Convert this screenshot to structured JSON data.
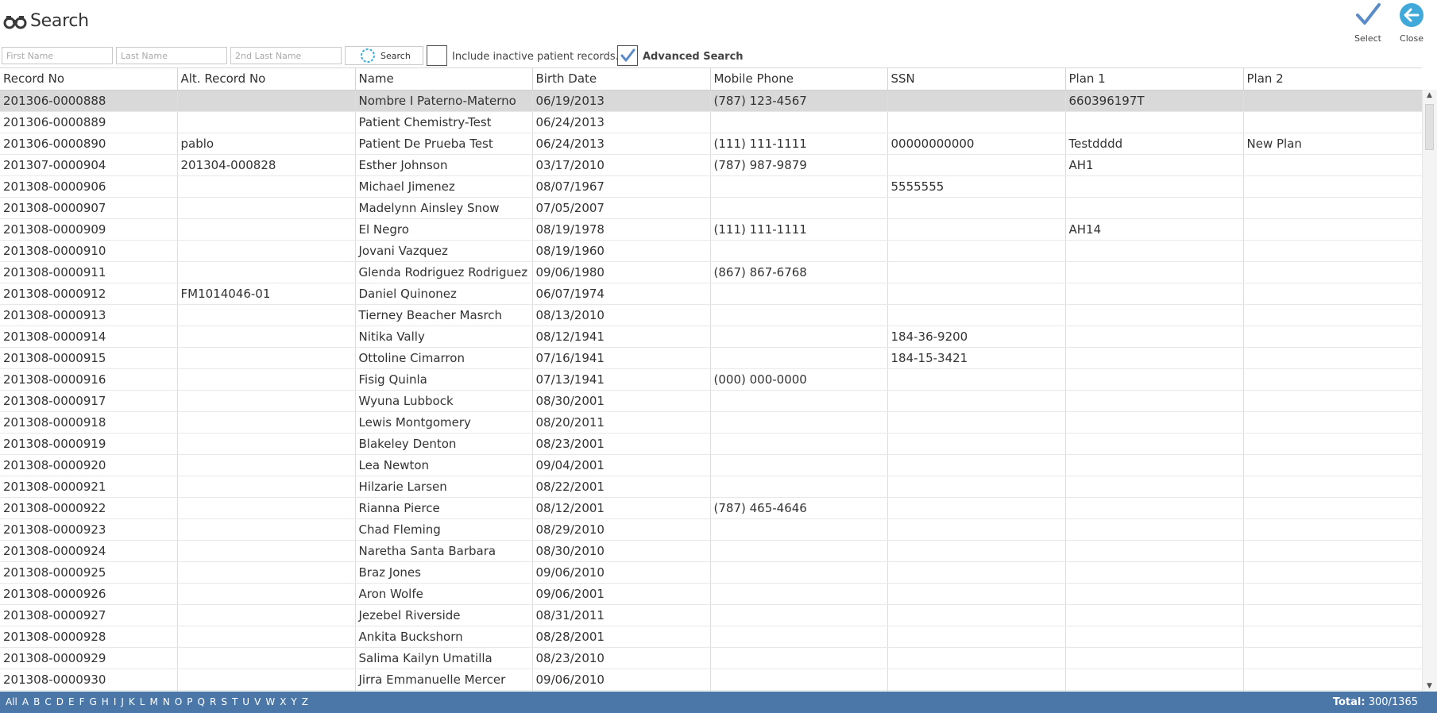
{
  "header": {
    "title": "Search",
    "select_label": "Select",
    "close_label": "Close",
    "accent_color": "#5b8cc7",
    "close_color": "#41a9d9"
  },
  "search_bar": {
    "first_name_placeholder": "First Name",
    "last_name_placeholder": "Last Name",
    "second_last_name_placeholder": "2nd Last Name",
    "search_label": "Search",
    "include_inactive_label": "Include inactive patient records.",
    "include_inactive_checked": false,
    "advanced_search_label": "Advanced Search",
    "advanced_search_checked": true
  },
  "grid": {
    "columns": [
      "Record No",
      "Alt. Record No",
      "Name",
      "Birth Date",
      "Mobile Phone",
      "SSN",
      "Plan 1",
      "Plan 2"
    ],
    "selected_row": 0,
    "rows": [
      [
        "201306-0000888",
        "",
        "Nombre I Paterno-Materno",
        "06/19/2013",
        "(787) 123-4567",
        "",
        "660396197T",
        ""
      ],
      [
        "201306-0000889",
        "",
        "Patient Chemistry-Test",
        "06/24/2013",
        "",
        "",
        "",
        ""
      ],
      [
        "201306-0000890",
        "pablo",
        "Patient De Prueba Test",
        "06/24/2013",
        "(111) 111-1111",
        "00000000000",
        "Testdddd",
        "New Plan"
      ],
      [
        "201307-0000904",
        "201304-000828",
        "Esther Johnson",
        "03/17/2010",
        "(787) 987-9879",
        "",
        "AH1",
        ""
      ],
      [
        "201308-0000906",
        "",
        "Michael Jimenez",
        "08/07/1967",
        "",
        "5555555",
        "",
        ""
      ],
      [
        "201308-0000907",
        "",
        "Madelynn Ainsley Snow",
        "07/05/2007",
        "",
        "",
        "",
        ""
      ],
      [
        "201308-0000909",
        "",
        "El Negro",
        "08/19/1978",
        "(111) 111-1111",
        "",
        "AH14",
        ""
      ],
      [
        "201308-0000910",
        "",
        "Jovani Vazquez",
        "08/19/1960",
        "",
        "",
        "",
        ""
      ],
      [
        "201308-0000911",
        "",
        "Glenda Rodriguez Rodriguez",
        "09/06/1980",
        "(867) 867-6768",
        "",
        "",
        ""
      ],
      [
        "201308-0000912",
        "FM1014046-01",
        "Daniel Quinonez",
        "06/07/1974",
        "",
        "",
        "",
        ""
      ],
      [
        "201308-0000913",
        "",
        "Tierney Beacher Masrch",
        "08/13/2010",
        "",
        "",
        "",
        ""
      ],
      [
        "201308-0000914",
        "",
        "Nitika Vally",
        "08/12/1941",
        "",
        "184-36-9200",
        "",
        ""
      ],
      [
        "201308-0000915",
        "",
        "Ottoline Cimarron",
        "07/16/1941",
        "",
        "184-15-3421",
        "",
        ""
      ],
      [
        "201308-0000916",
        "",
        "Fisig Quinla",
        "07/13/1941",
        "(000) 000-0000",
        "",
        "",
        ""
      ],
      [
        "201308-0000917",
        "",
        "Wyuna Lubbock",
        "08/30/2001",
        "",
        "",
        "",
        ""
      ],
      [
        "201308-0000918",
        "",
        "Lewis Montgomery",
        "08/20/2011",
        "",
        "",
        "",
        ""
      ],
      [
        "201308-0000919",
        "",
        "Blakeley Denton",
        "08/23/2001",
        "",
        "",
        "",
        ""
      ],
      [
        "201308-0000920",
        "",
        "Lea Newton",
        "09/04/2001",
        "",
        "",
        "",
        ""
      ],
      [
        "201308-0000921",
        "",
        "Hilzarie Larsen",
        "08/22/2001",
        "",
        "",
        "",
        ""
      ],
      [
        "201308-0000922",
        "",
        "Rianna Pierce",
        "08/12/2001",
        "(787) 465-4646",
        "",
        "",
        ""
      ],
      [
        "201308-0000923",
        "",
        "Chad Fleming",
        "08/29/2010",
        "",
        "",
        "",
        ""
      ],
      [
        "201308-0000924",
        "",
        "Naretha Santa Barbara",
        "08/30/2010",
        "",
        "",
        "",
        ""
      ],
      [
        "201308-0000925",
        "",
        "Braz Jones",
        "09/06/2010",
        "",
        "",
        "",
        ""
      ],
      [
        "201308-0000926",
        "",
        "Aron Wolfe",
        "09/06/2001",
        "",
        "",
        "",
        ""
      ],
      [
        "201308-0000927",
        "",
        "Jezebel Riverside",
        "08/31/2011",
        "",
        "",
        "",
        ""
      ],
      [
        "201308-0000928",
        "",
        "Ankita Buckshorn",
        "08/28/2001",
        "",
        "",
        "",
        ""
      ],
      [
        "201308-0000929",
        "",
        "Salima Kailyn Umatilla",
        "08/23/2010",
        "",
        "",
        "",
        ""
      ],
      [
        "201308-0000930",
        "",
        "Jirra Emmanuelle Mercer",
        "09/06/2010",
        "",
        "",
        "",
        ""
      ],
      [
        "",
        "",
        "",
        "",
        "",
        "",
        "",
        ""
      ]
    ]
  },
  "footer": {
    "alphabet": [
      "All",
      "A",
      "B",
      "C",
      "D",
      "E",
      "F",
      "G",
      "H",
      "I",
      "J",
      "K",
      "L",
      "M",
      "N",
      "O",
      "P",
      "Q",
      "R",
      "S",
      "T",
      "U",
      "V",
      "W",
      "X",
      "Y",
      "Z"
    ],
    "total_label": "Total:",
    "total_value": "300/1365",
    "bar_color": "#4a77a8"
  }
}
